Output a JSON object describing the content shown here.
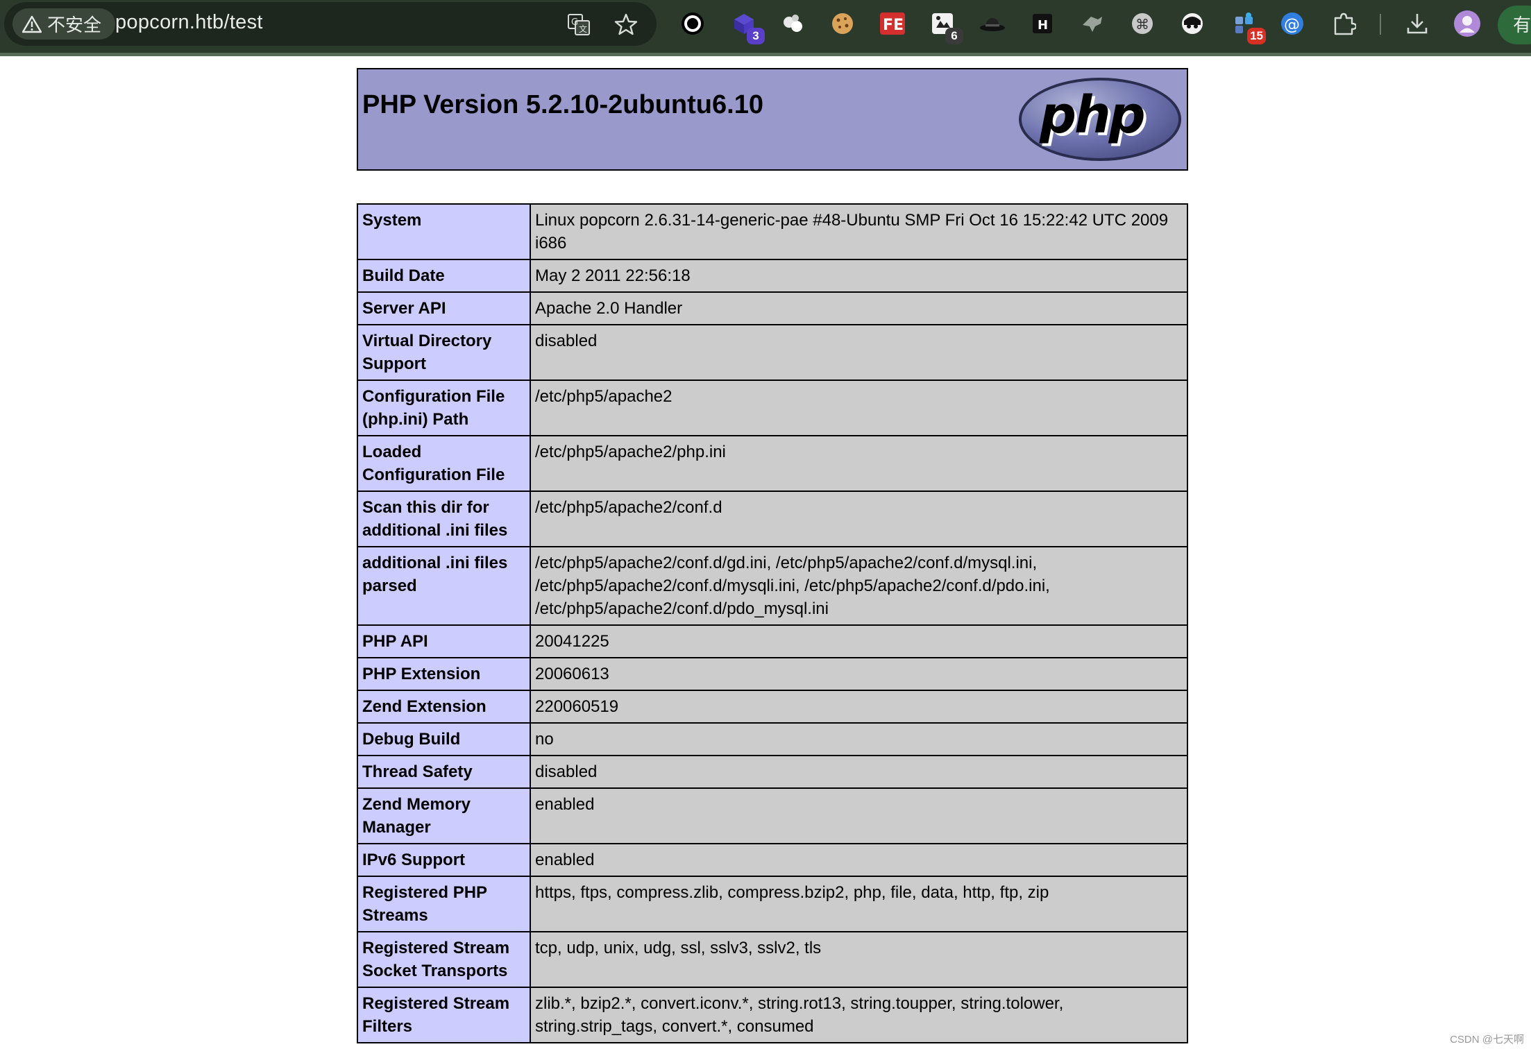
{
  "browser": {
    "security_label": "不安全",
    "url": "popcorn.htb/test",
    "profile_label": "有",
    "extension_badges": {
      "ext2": "3",
      "ext6": "6",
      "ext14": "15"
    },
    "extension_labels": {
      "fe": "FE",
      "h": "H",
      "at": "@"
    }
  },
  "phpinfo": {
    "title": "PHP Version 5.2.10-2ubuntu6.10",
    "logo_text": "php",
    "rows": [
      {
        "key": "System",
        "value": "Linux popcorn 2.6.31-14-generic-pae #48-Ubuntu SMP Fri Oct 16 15:22:42 UTC 2009 i686"
      },
      {
        "key": "Build Date",
        "value": "May 2 2011 22:56:18"
      },
      {
        "key": "Server API",
        "value": "Apache 2.0 Handler"
      },
      {
        "key": "Virtual Directory Support",
        "value": "disabled"
      },
      {
        "key": "Configuration File (php.ini) Path",
        "value": "/etc/php5/apache2"
      },
      {
        "key": "Loaded Configuration File",
        "value": "/etc/php5/apache2/php.ini"
      },
      {
        "key": "Scan this dir for additional .ini files",
        "value": "/etc/php5/apache2/conf.d"
      },
      {
        "key": "additional .ini files parsed",
        "value": "/etc/php5/apache2/conf.d/gd.ini, /etc/php5/apache2/conf.d/mysql.ini, /etc/php5/apache2/conf.d/mysqli.ini, /etc/php5/apache2/conf.d/pdo.ini, /etc/php5/apache2/conf.d/pdo_mysql.ini"
      },
      {
        "key": "PHP API",
        "value": "20041225"
      },
      {
        "key": "PHP Extension",
        "value": "20060613"
      },
      {
        "key": "Zend Extension",
        "value": "220060519"
      },
      {
        "key": "Debug Build",
        "value": "no"
      },
      {
        "key": "Thread Safety",
        "value": "disabled"
      },
      {
        "key": "Zend Memory Manager",
        "value": "enabled"
      },
      {
        "key": "IPv6 Support",
        "value": "enabled"
      },
      {
        "key": "Registered PHP Streams",
        "value": "https, ftps, compress.zlib, compress.bzip2, php, file, data, http, ftp, zip"
      },
      {
        "key": "Registered Stream Socket Transports",
        "value": "tcp, udp, unix, udg, ssl, sslv3, sslv2, tls"
      },
      {
        "key": "Registered Stream Filters",
        "value": "zlib.*, bzip2.*, convert.iconv.*, string.rot13, string.toupper, string.tolower, string.strip_tags, convert.*, consumed"
      }
    ]
  },
  "watermark": "CSDN @七天啊",
  "colors": {
    "header_bg": "#9999cc",
    "key_bg": "#ccccff",
    "value_bg": "#cccccc",
    "chrome_bg": "#2c3a2c"
  }
}
